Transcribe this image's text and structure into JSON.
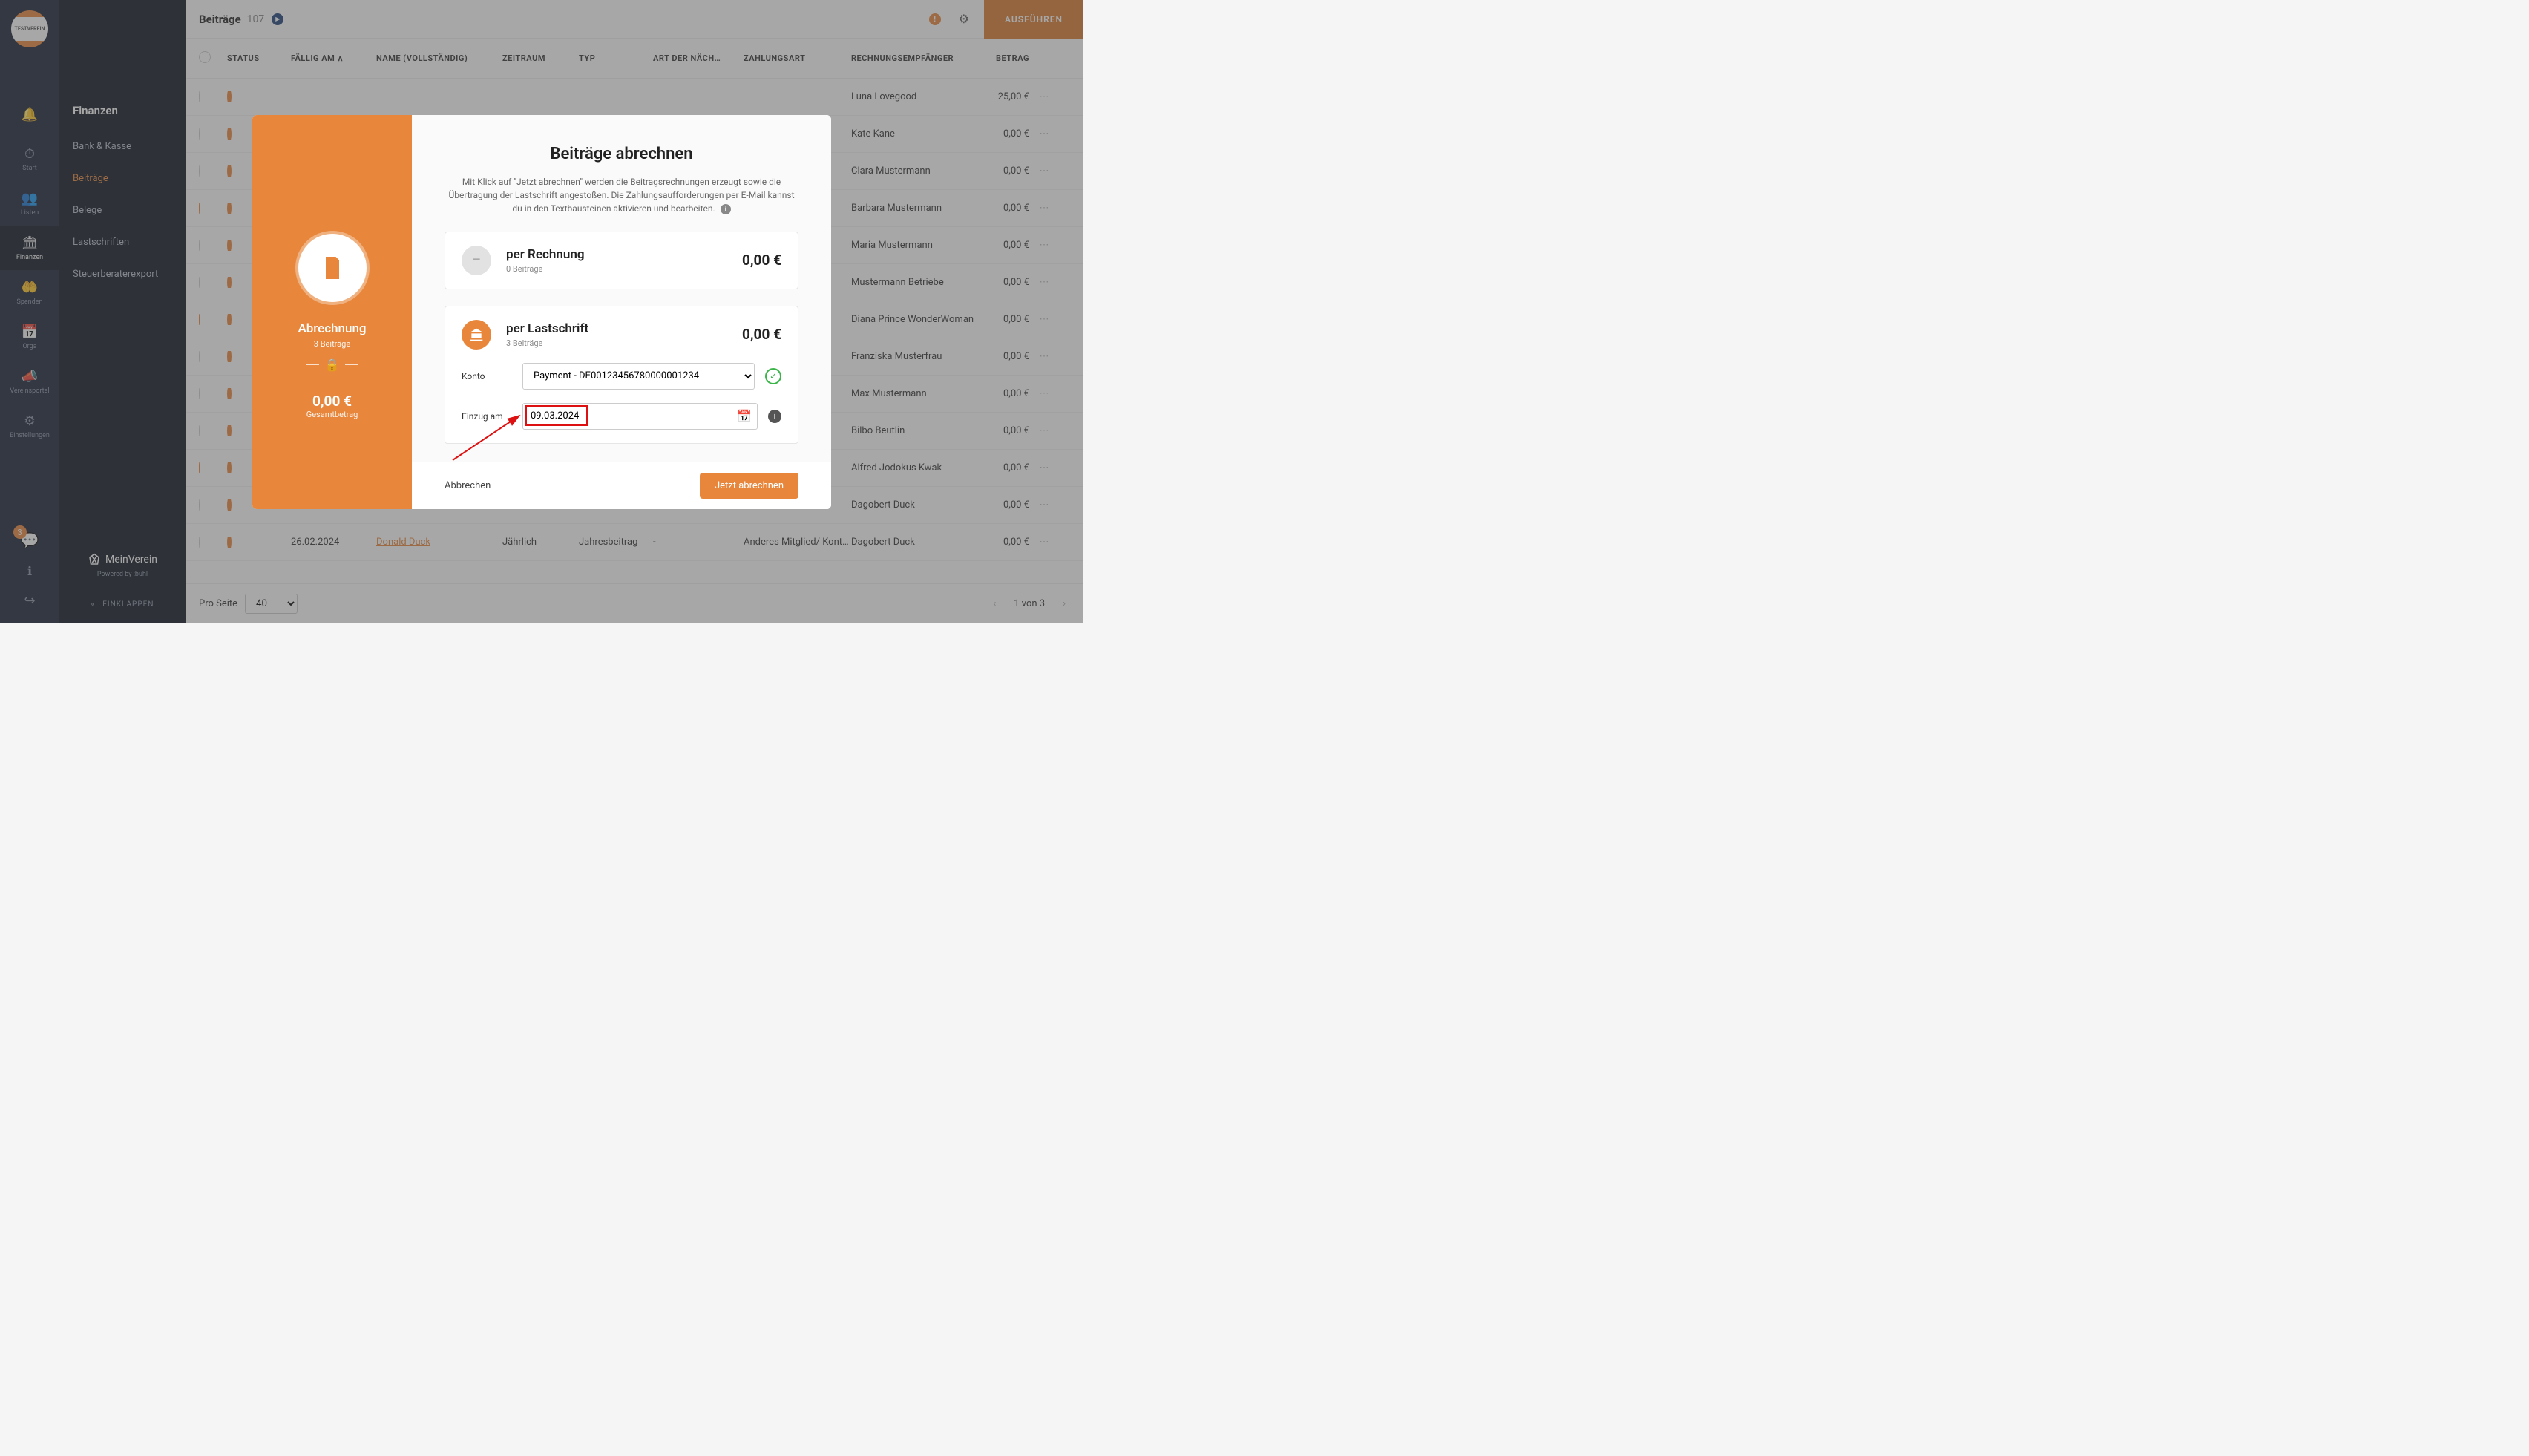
{
  "logo_text": "TESTVEREIN",
  "iconbar": {
    "items": [
      {
        "icon": "🔔",
        "label": ""
      },
      {
        "icon": "⏱",
        "label": "Start"
      },
      {
        "icon": "👥",
        "label": "Listen"
      },
      {
        "icon": "🏛",
        "label": "Finanzen"
      },
      {
        "icon": "🤲",
        "label": "Spenden"
      },
      {
        "icon": "📅",
        "label": "Orga"
      },
      {
        "icon": "📣",
        "label": "Vereinsportal"
      },
      {
        "icon": "⚙",
        "label": "Einstellungen"
      }
    ],
    "active_index": 3,
    "badge_count": "3",
    "chat_icon": "💬",
    "info_icon": "ℹ",
    "logout_icon": "↪"
  },
  "sidebar": {
    "title": "Finanzen",
    "items": [
      "Bank & Kasse",
      "Beiträge",
      "Belege",
      "Lastschriften",
      "Steuerberaterexport"
    ],
    "active_index": 1,
    "brand": "MeinVerein",
    "powered": "Powered by :buhl",
    "collapse": "EINKLAPPEN"
  },
  "topbar": {
    "title": "Beiträge",
    "count": "107",
    "execute": "AUSFÜHREN"
  },
  "columns": {
    "status": "STATUS",
    "due": "FÄLLIG AM",
    "name": "NAME (VOLLSTÄNDIG)",
    "period": "ZEITRAUM",
    "type": "TYP",
    "art": "ART DER NÄCH…",
    "pay": "ZAHLUNGSART",
    "recipient": "RECHNUNGSEMPFÄNGER",
    "amount": "BETRAG"
  },
  "rows": [
    {
      "checked": false,
      "due": "",
      "name": "",
      "period": "",
      "type": "",
      "art": "",
      "pay": "",
      "recipient": "Luna Lovegood",
      "amount": "25,00 €"
    },
    {
      "checked": false,
      "due": "",
      "name": "",
      "period": "",
      "type": "",
      "art": "",
      "pay": "",
      "recipient": "Kate Kane",
      "amount": "0,00 €"
    },
    {
      "checked": false,
      "due": "",
      "name": "",
      "period": "",
      "type": "",
      "art": "",
      "pay": "",
      "recipient": "Clara Mustermann",
      "amount": "0,00 €"
    },
    {
      "checked": true,
      "due": "",
      "name": "",
      "period": "",
      "type": "",
      "art": "",
      "pay": "",
      "recipient": "Barbara Mustermann",
      "amount": "0,00 €"
    },
    {
      "checked": false,
      "due": "",
      "name": "",
      "period": "",
      "type": "",
      "art": "",
      "pay": "",
      "recipient": "Maria Mustermann",
      "amount": "0,00 €"
    },
    {
      "checked": false,
      "due": "",
      "name": "",
      "period": "",
      "type": "",
      "art": "",
      "pay": "",
      "recipient": "Mustermann Betriebe",
      "amount": "0,00 €"
    },
    {
      "checked": true,
      "due": "",
      "name": "",
      "period": "",
      "type": "",
      "art": "",
      "pay": "",
      "recipient": "Diana Prince WonderWoman",
      "amount": "0,00 €"
    },
    {
      "checked": false,
      "due": "",
      "name": "",
      "period": "",
      "type": "",
      "art": "",
      "pay": "",
      "recipient": "Franziska Musterfrau",
      "amount": "0,00 €"
    },
    {
      "checked": false,
      "due": "",
      "name": "",
      "period": "",
      "type": "",
      "art": "",
      "pay": "",
      "recipient": "Max Mustermann",
      "amount": "0,00 €"
    },
    {
      "checked": false,
      "due": "",
      "name": "",
      "period": "",
      "type": "",
      "art": "",
      "pay": "",
      "recipient": "Bilbo Beutlin",
      "amount": "0,00 €"
    },
    {
      "checked": true,
      "due": "",
      "name": "",
      "period": "",
      "type": "",
      "art": "",
      "pay": "",
      "recipient": "Alfred Jodokus Kwak",
      "amount": "0,00 €"
    },
    {
      "checked": false,
      "due": "",
      "name": "",
      "period": "",
      "type": "",
      "art": "",
      "pay": "",
      "recipient": "Dagobert Duck",
      "amount": "0,00 €"
    },
    {
      "checked": false,
      "due": "26.02.2024",
      "name": "Donald Duck",
      "name_link": true,
      "period": "Jährlich",
      "type": "Jahresbeitrag",
      "art": "-",
      "pay": "Anderes Mitglied/ Kontakt",
      "recipient": "Dagobert Duck",
      "amount": "0,00 €"
    }
  ],
  "pager": {
    "per_label": "Pro Seite",
    "per_value": "40",
    "info": "1 von 3"
  },
  "modal": {
    "side": {
      "title": "Abrechnung",
      "sub": "3 Beiträge",
      "amount": "0,00 €",
      "amount_label": "Gesamtbetrag"
    },
    "title": "Beiträge abrechnen",
    "desc": "Mit Klick auf \"Jetzt abrechnen\" werden die Beitragsrechnungen erzeugt sowie die Übertragung der Lastschrift angestoßen. Die Zahlungsaufforderungen per E-Mail kannst du in den Textbausteinen aktivieren und bearbeiten.",
    "card_invoice": {
      "title": "per Rechnung",
      "sub": "0 Beiträge",
      "amount": "0,00 €"
    },
    "card_debit": {
      "title": "per Lastschrift",
      "sub": "3 Beiträge",
      "amount": "0,00 €",
      "konto_label": "Konto",
      "konto_value": "Payment - DE00123456780000001234",
      "date_label": "Einzug am",
      "date_value": "09.03.2024"
    },
    "cancel": "Abbrechen",
    "submit": "Jetzt abrechnen"
  }
}
